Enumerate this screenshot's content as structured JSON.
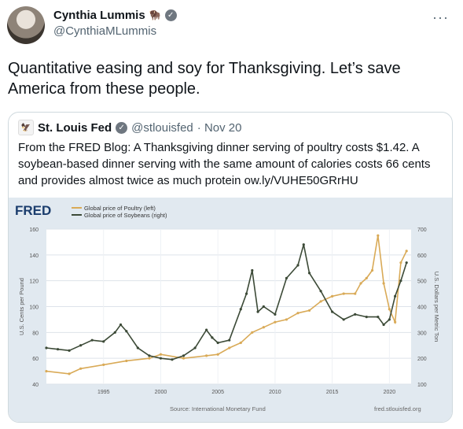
{
  "tweet": {
    "author_name": "Cynthia Lummis",
    "author_emoji": "🦬",
    "handle": "@CynthiaMLummis",
    "text": "Quantitative easing and soy for Thanksgiving. Let’s save America from these people.",
    "more_icon": "more-icon"
  },
  "quote": {
    "author_name": "St. Louis Fed",
    "handle": "@stlouisfed",
    "date": "· Nov 20",
    "text": "From the FRED Blog: A Thanksgiving dinner serving of poultry costs $1.42. A soybean-based dinner serving with the same amount of calories costs 66 cents and provides almost twice as much protein ow.ly/VUHE50GRrHU"
  },
  "chart_data": {
    "type": "line",
    "brand": "FRED",
    "legend_position": "top-left",
    "left_axis_label": "U.S. Cents per Pound",
    "right_axis_label": "U.S. Dollars per Metric Ton",
    "source": "Source: International Monetary Fund",
    "site": "fred.stlouisfed.org",
    "x_ticks": [
      "1995",
      "2000",
      "2005",
      "2010",
      "2015",
      "2020"
    ],
    "left_ticks": [
      "40",
      "60",
      "80",
      "100",
      "120",
      "140",
      "160"
    ],
    "right_ticks": [
      "100",
      "200",
      "300",
      "400",
      "500",
      "600",
      "700"
    ],
    "xlim": [
      1990,
      2021.9
    ],
    "ylim_left": [
      40,
      160
    ],
    "ylim_right": [
      100,
      700
    ],
    "colors": {
      "poultry": "#d9aa57",
      "soybeans": "#3c4a37",
      "plot_bg": "#ffffff",
      "panel_bg": "#e1e9f0"
    },
    "series": [
      {
        "name": "Global price of Poultry (left)",
        "axis": "left",
        "x": [
          1990,
          1992,
          1993,
          1995,
          1997,
          1999,
          2000,
          2002,
          2004,
          2005,
          2006,
          2007,
          2008,
          2009,
          2010,
          2011,
          2012,
          2013,
          2014,
          2015,
          2016,
          2017,
          2017.5,
          2018,
          2018.5,
          2019,
          2019.5,
          2020,
          2020.5,
          2021,
          2021.5
        ],
        "y": [
          50,
          48,
          52,
          55,
          58,
          60,
          63,
          60,
          62,
          63,
          68,
          72,
          80,
          84,
          88,
          90,
          95,
          97,
          104,
          108,
          110,
          110,
          118,
          122,
          128,
          155,
          118,
          98,
          88,
          134,
          143
        ]
      },
      {
        "name": "Global price of Soybeans (right)",
        "axis": "right",
        "x": [
          1990,
          1991,
          1992,
          1993,
          1994,
          1995,
          1996,
          1996.5,
          1997,
          1998,
          1999,
          2000,
          2001,
          2002,
          2003,
          2004,
          2004.5,
          2005,
          2006,
          2007,
          2007.5,
          2008,
          2008.5,
          2009,
          2010,
          2011,
          2012,
          2012.5,
          2013,
          2014,
          2015,
          2016,
          2017,
          2018,
          2019,
          2019.5,
          2020,
          2020.5,
          2021,
          2021.5
        ],
        "y": [
          240,
          235,
          230,
          250,
          270,
          265,
          300,
          330,
          305,
          240,
          210,
          200,
          195,
          210,
          240,
          310,
          280,
          260,
          270,
          390,
          450,
          540,
          380,
          400,
          370,
          510,
          560,
          640,
          530,
          460,
          380,
          350,
          370,
          360,
          360,
          330,
          350,
          440,
          500,
          570
        ]
      }
    ]
  }
}
